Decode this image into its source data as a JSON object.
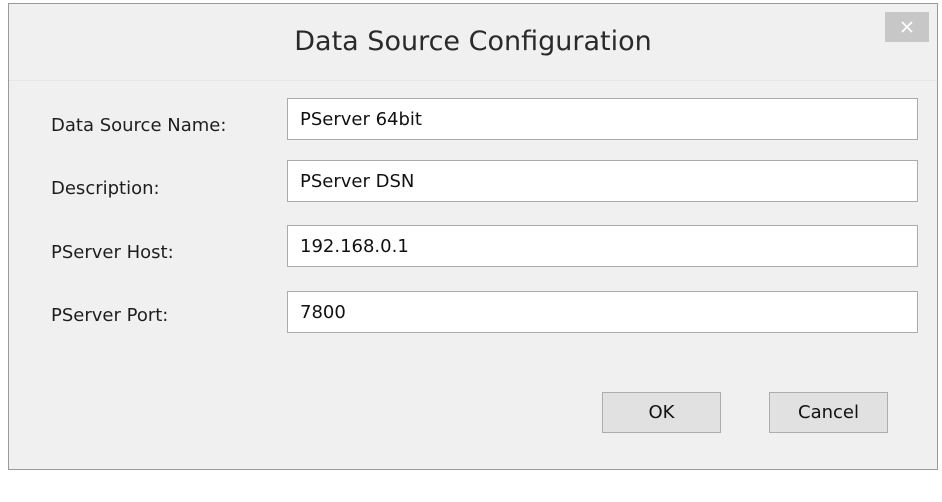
{
  "window": {
    "title": "Data Source Configuration",
    "close_icon": "close-icon"
  },
  "form": {
    "fields": [
      {
        "label": "Data Source Name:",
        "value": "PServer 64bit"
      },
      {
        "label": "Description:",
        "value": "PServer DSN"
      },
      {
        "label": "PServer Host:",
        "value": "192.168.0.1"
      },
      {
        "label": "PServer Port:",
        "value": "7800"
      }
    ]
  },
  "buttons": {
    "ok_label": "OK",
    "cancel_label": "Cancel"
  },
  "colors": {
    "dialog_background": "#f0f0f0",
    "close_button_background": "#c7c7c7",
    "button_background": "#e1e1e1"
  }
}
